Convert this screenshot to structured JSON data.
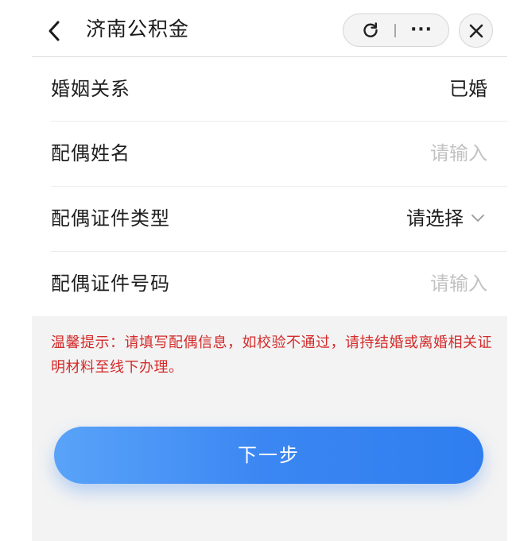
{
  "nav": {
    "title": "济南公积金",
    "back_icon": "chevron-left-icon",
    "refresh_icon": "refresh-icon",
    "more_icon": "more-dots-icon",
    "more_label": "···",
    "close_icon": "close-icon"
  },
  "form": {
    "rows": [
      {
        "label": "婚姻关系",
        "value": "已婚",
        "kind": "value"
      },
      {
        "label": "配偶姓名",
        "value": "请输入",
        "kind": "placeholder"
      },
      {
        "label": "配偶证件类型",
        "value": "请选择",
        "kind": "select",
        "icon": "chevron-down-icon"
      },
      {
        "label": "配偶证件号码",
        "value": "请输入",
        "kind": "placeholder"
      }
    ]
  },
  "tip": {
    "text": "温馨提示：请填写配偶信息，如校验不通过，请持结婚或离婚相关证明材料至线下办理。"
  },
  "next_button": {
    "label": "下一步"
  },
  "colors": {
    "accent": "#3a86f2",
    "tip_text": "#d42a2a",
    "placeholder": "#c2c2c2",
    "background_gray": "#f3f3f3"
  }
}
